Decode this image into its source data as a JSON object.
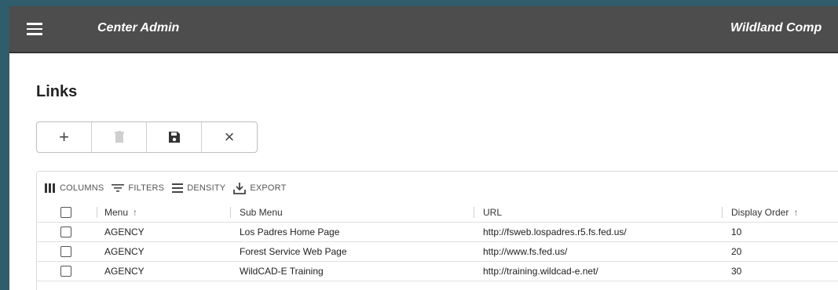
{
  "appbar": {
    "title": "Center Admin",
    "app_name": "Wildland Comp"
  },
  "page": {
    "title": "Links"
  },
  "toolbar": {
    "add": "+",
    "cancel": "×"
  },
  "grid_toolbar": {
    "columns": "COLUMNS",
    "filters": "FILTERS",
    "density": "DENSITY",
    "export": "EXPORT"
  },
  "columns": {
    "menu": "Menu",
    "sub_menu": "Sub Menu",
    "url": "URL",
    "display_order": "Display Order",
    "sort_glyph": "↑"
  },
  "rows": [
    {
      "menu": "AGENCY",
      "sub_menu": "Los Padres Home Page",
      "url": "http://fsweb.lospadres.r5.fs.fed.us/",
      "display_order": "10"
    },
    {
      "menu": "AGENCY",
      "sub_menu": "Forest Service Web Page",
      "url": "http://www.fs.fed.us/",
      "display_order": "20"
    },
    {
      "menu": "AGENCY",
      "sub_menu": "WildCAD-E Training",
      "url": "http://training.wildcad-e.net/",
      "display_order": "30"
    }
  ]
}
